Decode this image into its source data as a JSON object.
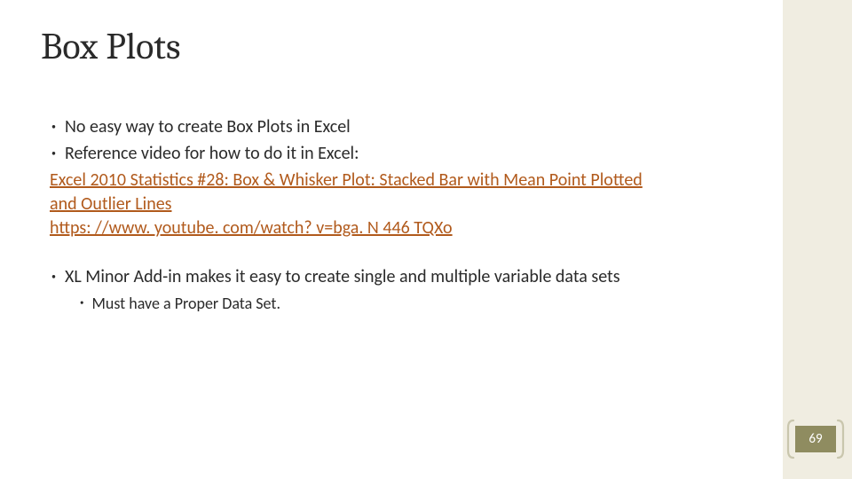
{
  "title": "Box Plots",
  "bullets": {
    "b1": "No easy way to create Box Plots in Excel",
    "b2": "Reference video for how to do it in Excel:"
  },
  "link": {
    "line1": "Excel 2010 Statistics #28: Box & Whisker Plot: Stacked Bar with Mean Point Plotted",
    "line2": "and Outlier Lines",
    "url": "https: //www. youtube. com/watch? v=bga. N 446 TQXo"
  },
  "bullets2": {
    "b3": "XL Minor Add-in makes it easy to create single and multiple variable data sets",
    "sub1": "Must have a Proper Data Set."
  },
  "page_number": "69"
}
